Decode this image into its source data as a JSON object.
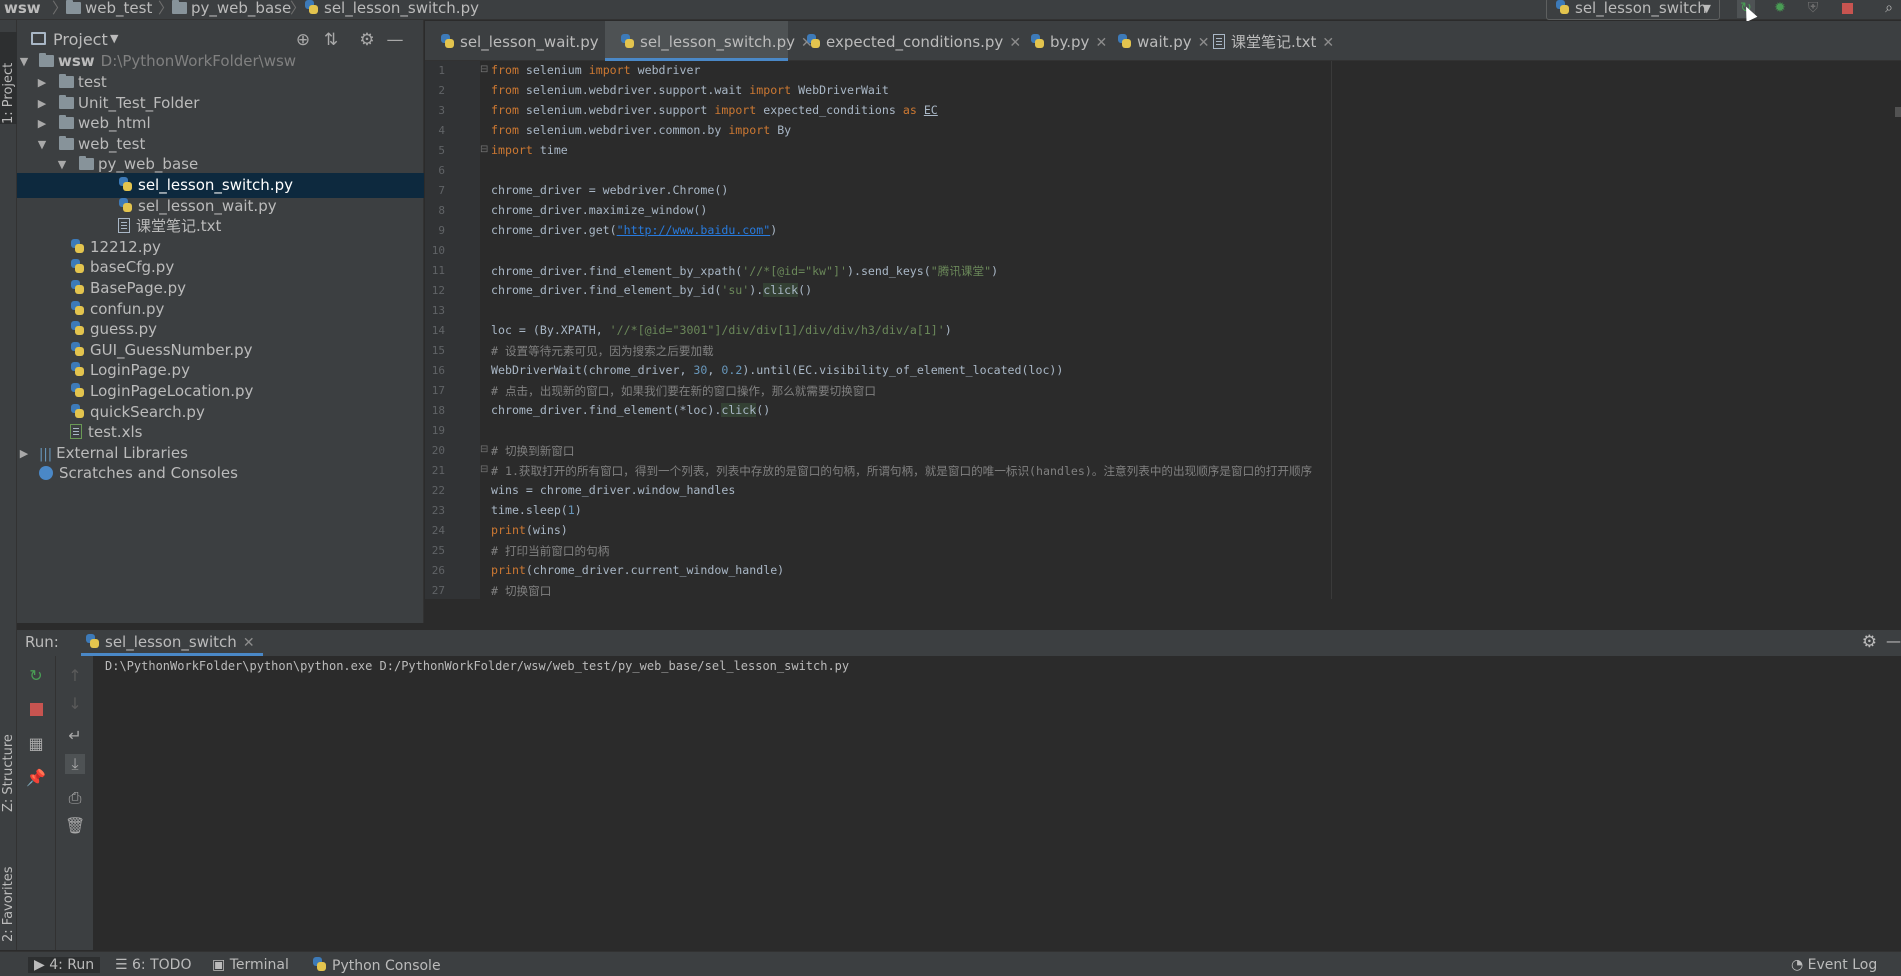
{
  "breadcrumb": {
    "root": "wsw",
    "folder1": "web_test",
    "folder2": "py_web_base",
    "file": "sel_lesson_switch.py"
  },
  "toolbar": {
    "run_config": "sel_lesson_switch"
  },
  "left_strip": {
    "project_tab": "1: Project",
    "structure_tab": "Z: Structure",
    "favorites_tab": "2: Favorites"
  },
  "project_panel": {
    "title": "Project",
    "tree": [
      {
        "label": "wsw",
        "path": "D:\\PythonWorkFolder\\wsw"
      },
      {
        "label": "test"
      },
      {
        "label": "Unit_Test_Folder"
      },
      {
        "label": "web_html"
      },
      {
        "label": "web_test"
      },
      {
        "label": "py_web_base"
      },
      {
        "label": "sel_lesson_switch.py"
      },
      {
        "label": "sel_lesson_wait.py"
      },
      {
        "label": "课堂笔记.txt"
      },
      {
        "label": "12212.py"
      },
      {
        "label": "baseCfg.py"
      },
      {
        "label": "BasePage.py"
      },
      {
        "label": "confun.py"
      },
      {
        "label": "guess.py"
      },
      {
        "label": "GUI_GuessNumber.py"
      },
      {
        "label": "LoginPage.py"
      },
      {
        "label": "LoginPageLocation.py"
      },
      {
        "label": "quickSearch.py"
      },
      {
        "label": "test.xls"
      },
      {
        "label": "External Libraries"
      },
      {
        "label": "Scratches and Consoles"
      }
    ]
  },
  "editor_tabs": [
    {
      "label": "sel_lesson_wait.py"
    },
    {
      "label": "sel_lesson_switch.py"
    },
    {
      "label": "expected_conditions.py"
    },
    {
      "label": "by.py"
    },
    {
      "label": "wait.py"
    },
    {
      "label": "课堂笔记.txt"
    }
  ],
  "editor": {
    "line_numbers": [
      "1",
      "2",
      "3",
      "4",
      "5",
      "6",
      "7",
      "8",
      "9",
      "10",
      "11",
      "12",
      "13",
      "14",
      "15",
      "16",
      "17",
      "18",
      "19",
      "20",
      "21",
      "22",
      "23",
      "24",
      "25",
      "26",
      "27"
    ],
    "lines": {
      "l1": {
        "a": "from",
        "b": " selenium ",
        "c": "import",
        "d": " webdriver"
      },
      "l2": {
        "a": "from",
        "b": " selenium.webdriver.support.wait ",
        "c": "import",
        "d": " WebDriverWait"
      },
      "l3": {
        "a": "from",
        "b": " selenium.webdriver.support ",
        "c": "import",
        "d": " expected_conditions ",
        "e": "as",
        "f": "EC"
      },
      "l4": {
        "a": "from",
        "b": " selenium.webdriver.common.by ",
        "c": "import",
        "d": " By"
      },
      "l5": {
        "a": "import",
        "b": " time"
      },
      "l7": "chrome_driver = webdriver.Chrome()",
      "l8": "chrome_driver.maximize_window()",
      "l9": {
        "a": "chrome_driver.get(",
        "b": "\"http://www.baidu.com\"",
        "c": ")"
      },
      "l11": {
        "a": "chrome_driver.find_element_by_xpath(",
        "b": "'//*[@id=\"kw\"]'",
        "c": ").send_keys(",
        "d": "\"腾讯课堂\"",
        "e": ")"
      },
      "l12": {
        "a": "chrome_driver.find_element_by_id(",
        "b": "'su'",
        "c": ").",
        "d": "click",
        "e": "()"
      },
      "l14": {
        "a": "loc = (By.XPATH, ",
        "b": "'//*[@id=\"3001\"]/div/div[1]/div/div/h3/div/a[1]'",
        "c": ")"
      },
      "l15": "# 设置等待元素可见，因为搜索之后要加载",
      "l16": {
        "a": "WebDriverWait(chrome_driver, ",
        "b": "30",
        "c": ", ",
        "d": "0.2",
        "e": ").until(EC.visibility_of_element_located(loc))"
      },
      "l17": "# 点击，出现新的窗口，如果我们要在新的窗口操作，那么就需要切换窗口",
      "l18": {
        "a": "chrome_driver.find_element(*loc).",
        "b": "click",
        "c": "()"
      },
      "l20": "# 切换到新窗口",
      "l21": "# 1.获取打开的所有窗口，得到一个列表，列表中存放的是窗口的句柄，所谓句柄，就是窗口的唯一标识(handles)。注意列表中的出现顺序是窗口的打开顺序",
      "l22": "wins = chrome_driver.window_handles",
      "l23": {
        "a": "time.sleep(",
        "b": "1",
        "c": ")"
      },
      "l24": {
        "a": "print",
        "b": "(wins)"
      },
      "l25": "# 打印当前窗口的句柄",
      "l26": {
        "a": "print",
        "b": "(chrome_driver.current_window_handle)"
      },
      "l27": "# 切换窗口"
    }
  },
  "run_panel": {
    "title": "Run:",
    "tab": "sel_lesson_switch",
    "console": "D:\\PythonWorkFolder\\python\\python.exe D:/PythonWorkFolder/wsw/web_test/py_web_base/sel_lesson_switch.py"
  },
  "statusbar": {
    "run": "4: Run",
    "todo": "6: TODO",
    "terminal": "Terminal",
    "python_console": "Python Console",
    "event_log": "Event Log"
  },
  "colors": {
    "background": "#2b2b2b",
    "panel": "#3c3f41",
    "selection": "#0d293e",
    "keyword": "#cc7832",
    "string": "#6a8759",
    "number": "#6897bb",
    "comment": "#808080",
    "accent": "#4a88c7"
  },
  "icons": [
    "folder-icon",
    "python-file-icon",
    "text-file-icon",
    "locate-icon",
    "collapse-icon",
    "gear-icon",
    "minimize-icon",
    "rerun-icon",
    "debug-icon",
    "coverage-icon",
    "stop-icon",
    "search-icon"
  ]
}
